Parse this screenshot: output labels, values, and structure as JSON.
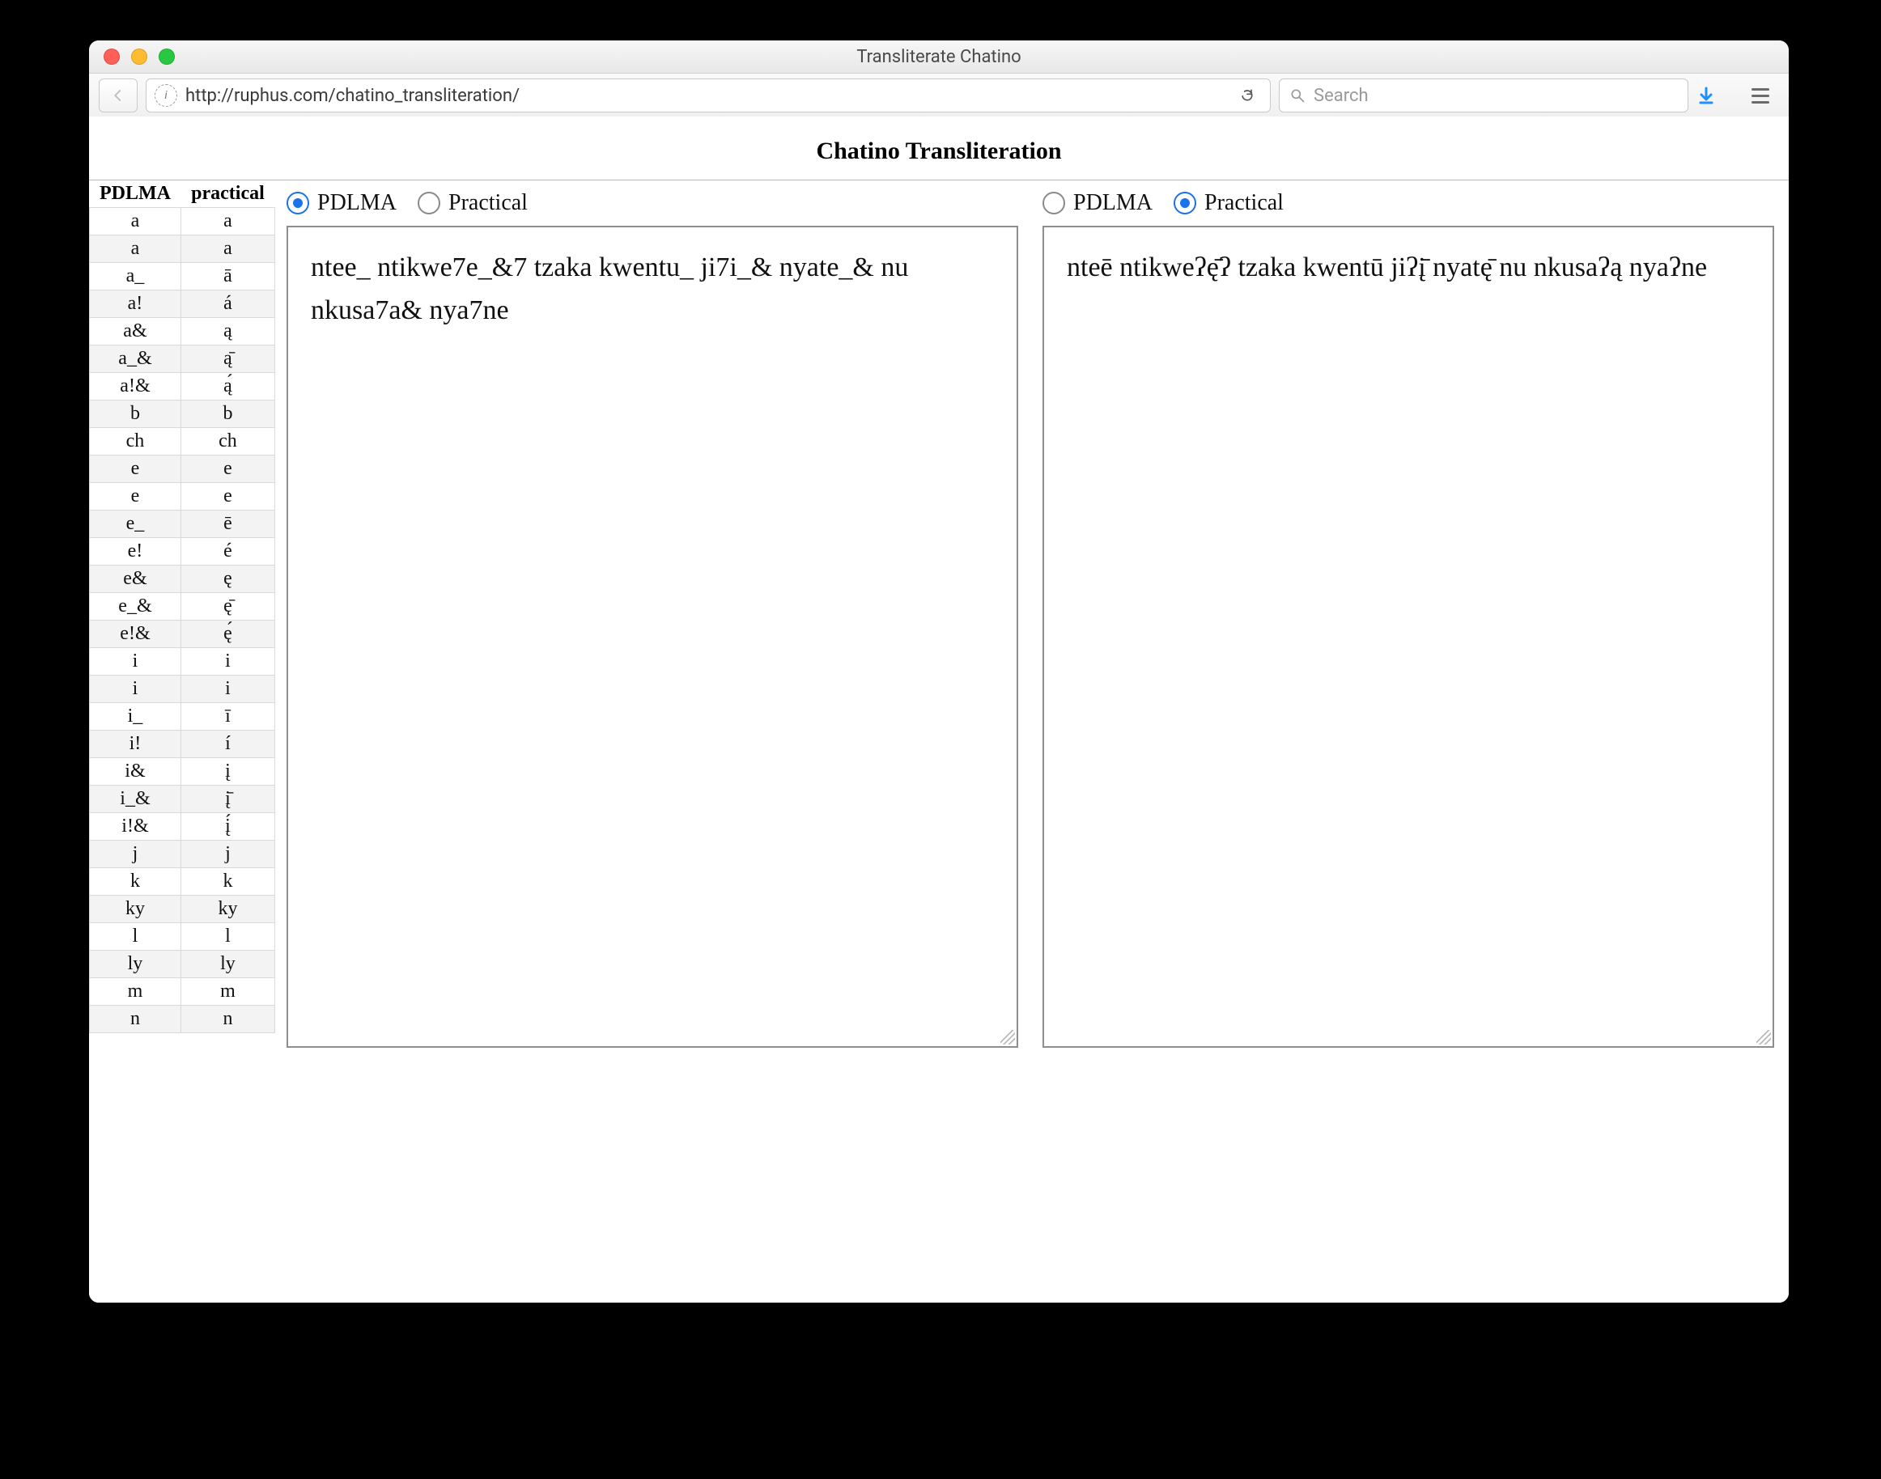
{
  "window": {
    "title": "Transliterate Chatino"
  },
  "toolbar": {
    "url": "http://ruphus.com/chatino_transliteration/",
    "search_placeholder": "Search"
  },
  "page": {
    "title": "Chatino Transliteration"
  },
  "table": {
    "headers": [
      "PDLMA",
      "practical"
    ],
    "rows": [
      [
        "a",
        "a"
      ],
      [
        "a",
        "a"
      ],
      [
        "a_",
        "ā"
      ],
      [
        "a!",
        "á"
      ],
      [
        "a&",
        "ą"
      ],
      [
        "a_&",
        "ą̄"
      ],
      [
        "a!&",
        "ą́"
      ],
      [
        "b",
        "b"
      ],
      [
        "ch",
        "ch"
      ],
      [
        "e",
        "e"
      ],
      [
        "e",
        "e"
      ],
      [
        "e_",
        "ē"
      ],
      [
        "e!",
        "é"
      ],
      [
        "e&",
        "ę"
      ],
      [
        "e_&",
        "ę̄"
      ],
      [
        "e!&",
        "ę́"
      ],
      [
        "i",
        "i"
      ],
      [
        "i",
        "i"
      ],
      [
        "i_",
        "ī"
      ],
      [
        "i!",
        "í"
      ],
      [
        "i&",
        "į"
      ],
      [
        "i_&",
        "į̄"
      ],
      [
        "i!&",
        "į́"
      ],
      [
        "j",
        "j"
      ],
      [
        "k",
        "k"
      ],
      [
        "ky",
        "ky"
      ],
      [
        "l",
        "l"
      ],
      [
        "ly",
        "ly"
      ],
      [
        "m",
        "m"
      ],
      [
        "n",
        "n"
      ]
    ]
  },
  "panels": {
    "left": {
      "radios": {
        "pdlma": "PDLMA",
        "practical": "Practical"
      },
      "selected": "pdlma",
      "text": "ntee_ ntikwe7e_&7 tzaka kwentu_ ji7i_& nyate_& nu nkusa7a& nya7ne"
    },
    "right": {
      "radios": {
        "pdlma": "PDLMA",
        "practical": "Practical"
      },
      "selected": "practical",
      "text": "nteē ntikweʔę̄ʔ tzaka kwentū jiʔį̄ nyatę̄ nu nkusaʔą nyaʔne"
    }
  }
}
